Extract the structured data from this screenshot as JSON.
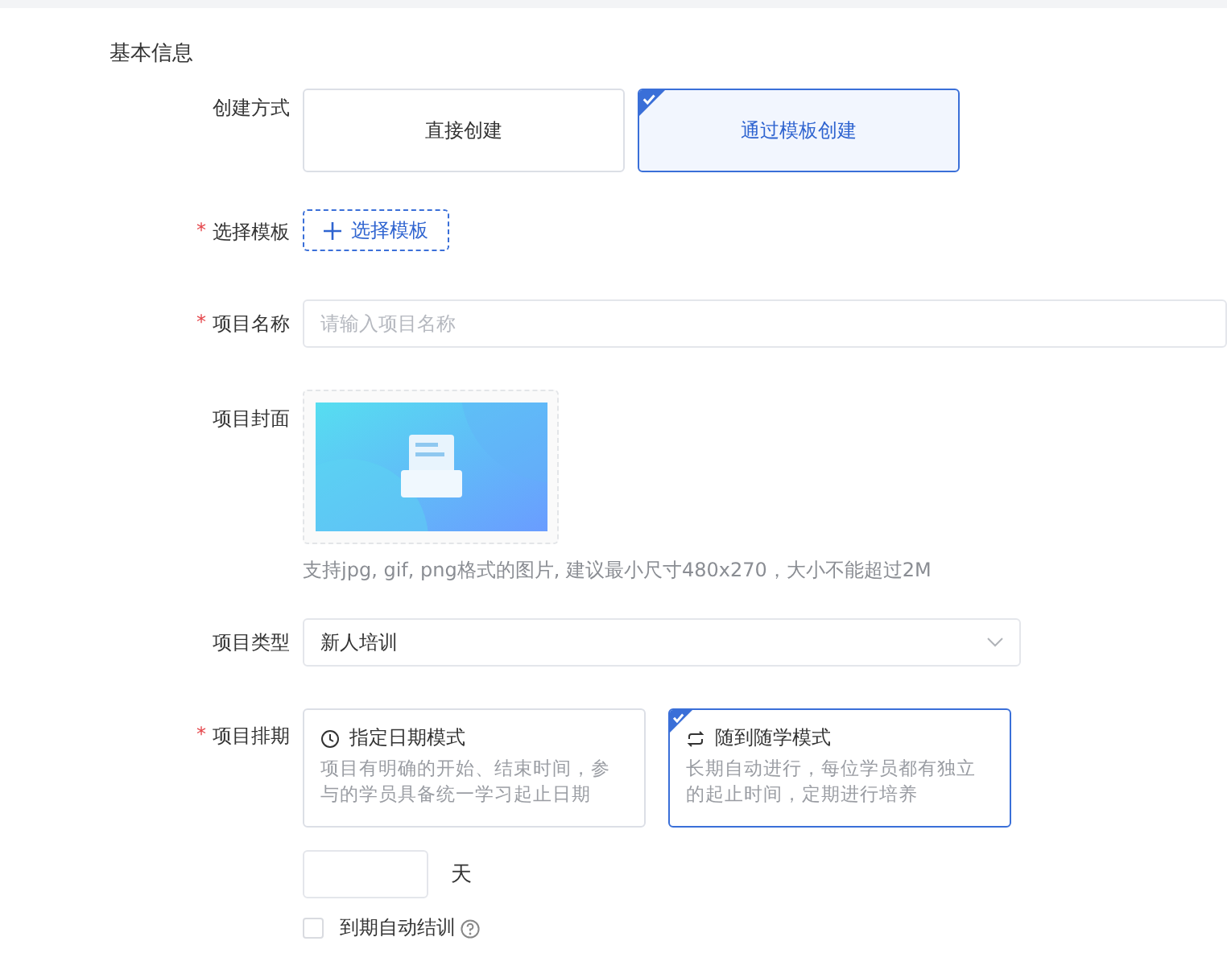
{
  "section_title": "基本信息",
  "create_mode": {
    "label": "创建方式",
    "options": [
      {
        "label": "直接创建",
        "selected": false
      },
      {
        "label": "通过模板创建",
        "selected": true
      }
    ]
  },
  "template": {
    "required_mark": "*",
    "label": "选择模板",
    "button": "选择模板"
  },
  "name": {
    "required_mark": "*",
    "label": "项目名称",
    "placeholder": "请输入项目名称"
  },
  "cover": {
    "label": "项目封面",
    "hint": "支持jpg, gif, png格式的图片, 建议最小尺寸480x270，大小不能超过2M"
  },
  "type": {
    "label": "项目类型",
    "value": "新人培训"
  },
  "schedule": {
    "required_mark": "*",
    "label": "项目排期",
    "options": [
      {
        "kind": "clock",
        "title": "指定日期模式",
        "description": "项目有明确的开始、结束时间，参与的学员具备统一学习起止日期",
        "selected": false
      },
      {
        "kind": "cycle",
        "title": "随到随学模式",
        "description": "长期自动进行，每位学员都有独立的起止时间，定期进行培养",
        "selected": true
      }
    ],
    "days_unit": "天",
    "auto_end": {
      "label": "到期自动结训",
      "checked": false
    }
  }
}
